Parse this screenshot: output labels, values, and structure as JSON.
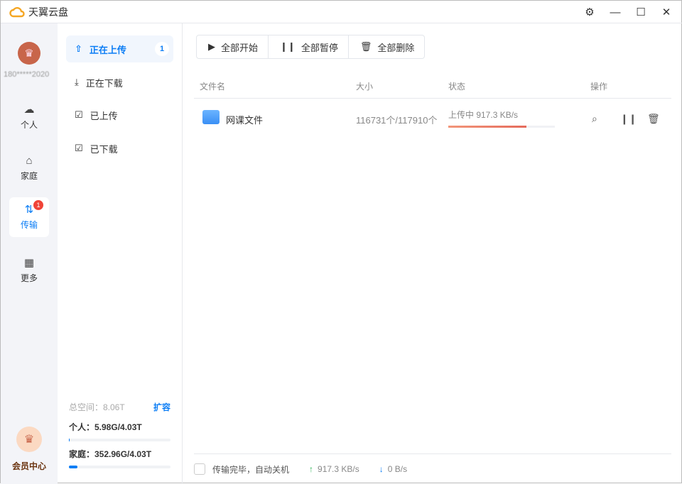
{
  "app": {
    "title": "天翼云盘"
  },
  "user": {
    "name": "180*****2020"
  },
  "nav": [
    {
      "label": "个人",
      "icon": "cloud-icon"
    },
    {
      "label": "家庭",
      "icon": "home-icon"
    },
    {
      "label": "传输",
      "icon": "transfer-icon",
      "badge": "1"
    },
    {
      "label": "更多",
      "icon": "grid-icon"
    }
  ],
  "vip": {
    "label": "会员中心"
  },
  "side": {
    "items": [
      {
        "label": "正在上传",
        "count": "1"
      },
      {
        "label": "正在下载"
      },
      {
        "label": "已上传"
      },
      {
        "label": "已下载"
      }
    ],
    "storage": {
      "total": "总空间：8.06T",
      "expand": "扩容",
      "personal": "个人：5.98G/4.03T",
      "personal_fraction": 0.0015,
      "family": "家庭：352.96G/4.03T",
      "family_fraction": 0.085
    }
  },
  "toolbar": {
    "start_all": "全部开始",
    "pause_all": "全部暂停",
    "delete_all": "全部删除"
  },
  "table": {
    "headers": [
      "文件名",
      "大小",
      "状态",
      "操作"
    ],
    "rows": [
      {
        "name": "网课文件",
        "size": "116731个/117910个",
        "status": "上传中 917.3 KB/s",
        "progress": 0.73
      }
    ]
  },
  "footer": {
    "shutdown": "传输完毕，自动关机",
    "up": "917.3 KB/s",
    "down": "0 B/s"
  },
  "colors": {
    "accent": "#0d7ef5",
    "progress": "#e56b5c"
  }
}
